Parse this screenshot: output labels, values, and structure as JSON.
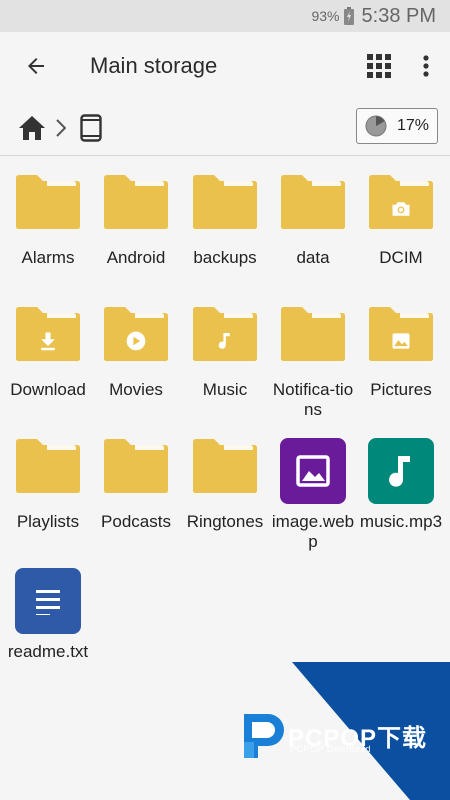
{
  "status_bar": {
    "battery": "93%",
    "time": "5:38 PM"
  },
  "toolbar": {
    "title": "Main storage"
  },
  "breadcrumb": {
    "usage": "17%",
    "usage_fraction": 0.17
  },
  "items": [
    {
      "label": "Alarms",
      "type": "folder",
      "badge": ""
    },
    {
      "label": "Android",
      "type": "folder",
      "badge": ""
    },
    {
      "label": "backups",
      "type": "folder",
      "badge": ""
    },
    {
      "label": "data",
      "type": "folder",
      "badge": ""
    },
    {
      "label": "DCIM",
      "type": "folder",
      "badge": "camera-icon"
    },
    {
      "label": "Download",
      "type": "folder",
      "badge": "download-icon"
    },
    {
      "label": "Movies",
      "type": "folder",
      "badge": "play-icon"
    },
    {
      "label": "Music",
      "type": "folder",
      "badge": "music-note-icon"
    },
    {
      "label": "Notifica-tions",
      "type": "folder",
      "badge": ""
    },
    {
      "label": "Pictures",
      "type": "folder",
      "badge": "image-icon"
    },
    {
      "label": "Playlists",
      "type": "folder",
      "badge": ""
    },
    {
      "label": "Podcasts",
      "type": "folder",
      "badge": ""
    },
    {
      "label": "Ringtones",
      "type": "folder",
      "badge": ""
    },
    {
      "label": "image.webp",
      "type": "image-file",
      "badge": "image-icon"
    },
    {
      "label": "music.mp3",
      "type": "audio-file",
      "badge": "music-note-icon"
    },
    {
      "label": "readme.txt",
      "type": "text-file",
      "badge": "text-lines-icon"
    }
  ],
  "colors": {
    "folder": "#e9c14c",
    "folder_back": "#d9ae36",
    "image_file": "#6a1b9a",
    "audio_file": "#00897b",
    "text_file": "#2f5aa8",
    "watermark_blue": "#0a4fa0"
  },
  "watermark": {
    "brand": "PCPOP下载",
    "sub": "PCPOP Download"
  }
}
